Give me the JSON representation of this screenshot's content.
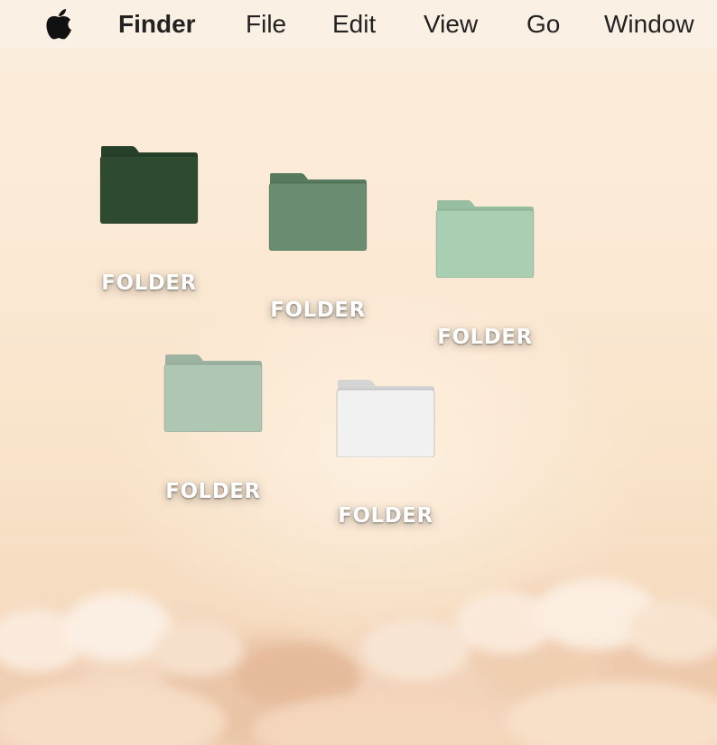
{
  "menubar": {
    "apple_icon": "apple-logo-icon",
    "app_name": "Finder",
    "items": [
      "File",
      "Edit",
      "View",
      "Go",
      "Window"
    ]
  },
  "desktop": {
    "folders": [
      {
        "label": "FOLDER",
        "color": "#2e4a30",
        "tab_color": "#26402a"
      },
      {
        "label": "FOLDER",
        "color": "#6a8c70",
        "tab_color": "#587a5e"
      },
      {
        "label": "FOLDER",
        "color": "#a9cfb2",
        "tab_color": "#97bea0"
      },
      {
        "label": "FOLDER",
        "color": "#afc6b3",
        "tab_color": "#9db3a1"
      },
      {
        "label": "FOLDER",
        "color": "#f1f1f1",
        "tab_color": "#d4d4d4"
      }
    ]
  },
  "colors": {
    "menubar_bg": "#fbf0e4",
    "wallpaper_top": "#fbeedd",
    "wallpaper_bottom": "#f3d6b8"
  }
}
